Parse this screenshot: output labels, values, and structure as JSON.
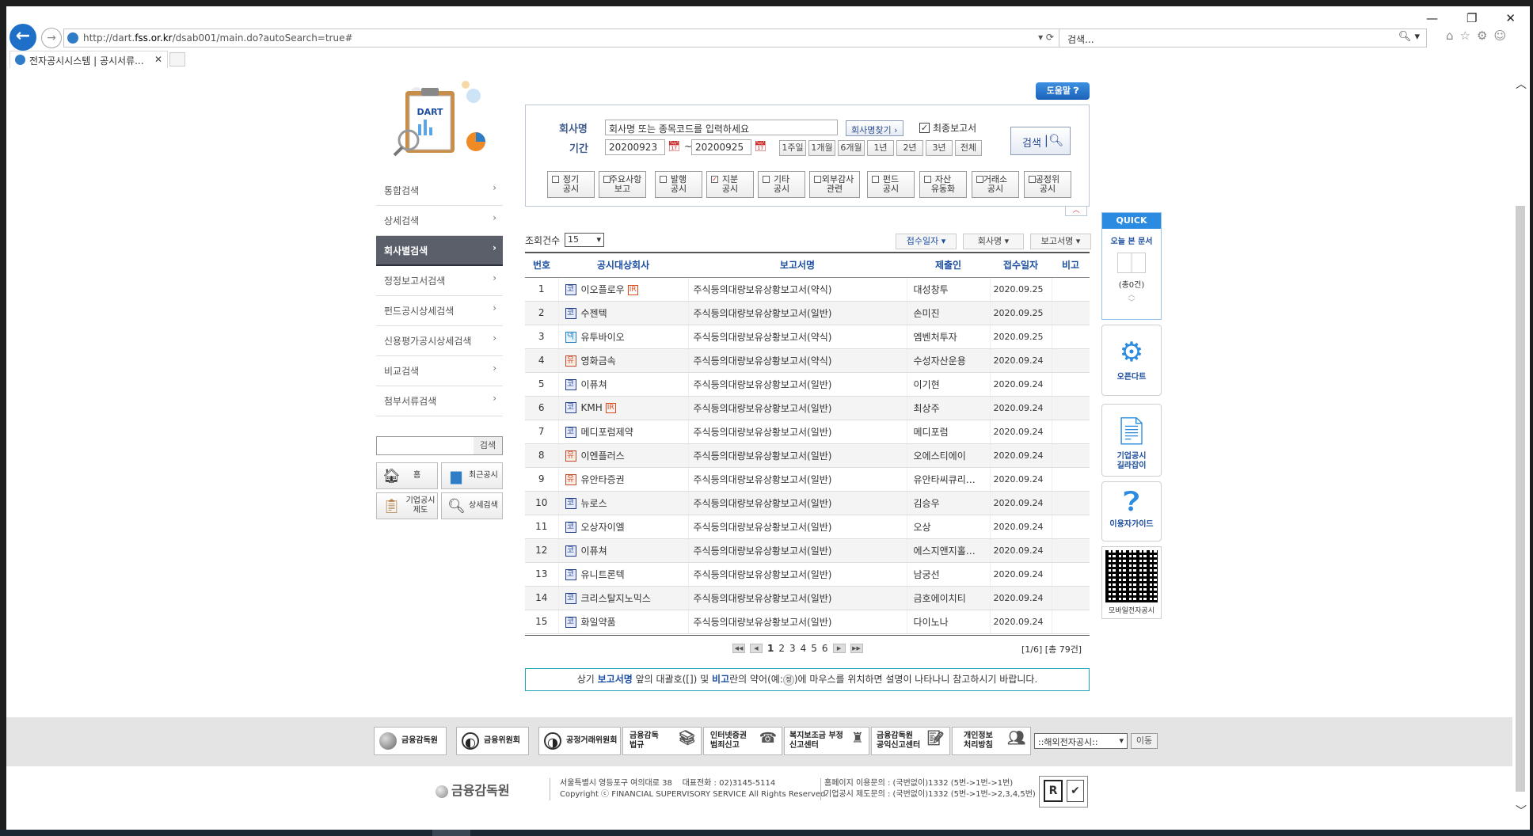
{
  "browser": {
    "url_prefix": "http://dart.",
    "url_host": "fss.or.kr",
    "url_rest": "/dsab001/main.do?autoSearch=true#",
    "search_placeholder": "검색...",
    "tab_title": "전자공시시스템 | 공시서류..."
  },
  "sidebar": {
    "logo_text": "DART",
    "items": [
      {
        "label": "통합검색"
      },
      {
        "label": "상세검색"
      },
      {
        "label": "회사별검색",
        "active": true
      },
      {
        "label": "정정보고서검색"
      },
      {
        "label": "펀드공시상세검색"
      },
      {
        "label": "신용평가공시상세검색"
      },
      {
        "label": "비교검색"
      },
      {
        "label": "첨부서류검색"
      }
    ],
    "search_button": "검색",
    "quick_buttons": [
      {
        "label": "홈",
        "icon": "home-icon"
      },
      {
        "label": "최근공시",
        "icon": "bar-chart-icon"
      },
      {
        "label": "기업공시 제도",
        "icon": "clipboard-icon"
      },
      {
        "label": "상세검색",
        "icon": "magnifier-icon"
      }
    ]
  },
  "search": {
    "help_label": "도움말",
    "company_label": "회사명",
    "company_value": "회사명 또는 종목코드를 입력하세요",
    "find_company_button": "회사명찾기",
    "latest_report_label": "최종보고서",
    "latest_report_checked": true,
    "period_label": "기간",
    "date_from": "20200923",
    "date_to": "20200925",
    "date_separator": "~",
    "period_buttons": [
      "1주일",
      "1개월",
      "6개월",
      "1년",
      "2년",
      "3년",
      "전체"
    ],
    "search_button": "검색",
    "categories": [
      {
        "label": "정기\n공시",
        "checked": false
      },
      {
        "label": "주요사항\n보고",
        "checked": false
      },
      {
        "label": "발행\n공시",
        "checked": false
      },
      {
        "label": "지분\n공시",
        "checked": true
      },
      {
        "label": "기타\n공시",
        "checked": false
      },
      {
        "label": "외부감사\n관련",
        "checked": false
      },
      {
        "label": "펀드\n공시",
        "checked": false
      },
      {
        "label": "자산\n유동화",
        "checked": false
      },
      {
        "label": "거래소\n공시",
        "checked": false
      },
      {
        "label": "공정위\n공시",
        "checked": false
      }
    ]
  },
  "results": {
    "count_label": "조회건수",
    "count_value": "15",
    "sort_buttons": [
      "접수일자",
      "회사명",
      "보고서명"
    ],
    "headers": [
      "번호",
      "공시대상회사",
      "보고서명",
      "제출인",
      "접수일자",
      "비고"
    ],
    "rows": [
      {
        "no": "1",
        "market": "코",
        "company": "이오플로우",
        "ir": "IR",
        "report": "주식등의대량보유상황보고서(약식)",
        "submitter": "대성창투",
        "date": "2020.09.25"
      },
      {
        "no": "2",
        "market": "코",
        "company": "수젠텍",
        "ir": "",
        "report": "주식등의대량보유상황보고서(일반)",
        "submitter": "손미진",
        "date": "2020.09.25"
      },
      {
        "no": "3",
        "market": "넥",
        "company": "유투바이오",
        "ir": "",
        "report": "주식등의대량보유상황보고서(약식)",
        "submitter": "엠벤처투자",
        "date": "2020.09.25"
      },
      {
        "no": "4",
        "market": "유",
        "company": "영화금속",
        "ir": "",
        "report": "주식등의대량보유상황보고서(약식)",
        "submitter": "수성자산운용",
        "date": "2020.09.24"
      },
      {
        "no": "5",
        "market": "코",
        "company": "이퓨쳐",
        "ir": "",
        "report": "주식등의대량보유상황보고서(일반)",
        "submitter": "이기현",
        "date": "2020.09.24"
      },
      {
        "no": "6",
        "market": "코",
        "company": "KMH",
        "ir": "IR",
        "report": "주식등의대량보유상황보고서(일반)",
        "submitter": "최상주",
        "date": "2020.09.24"
      },
      {
        "no": "7",
        "market": "코",
        "company": "메디포럼제약",
        "ir": "",
        "report": "주식등의대량보유상황보고서(일반)",
        "submitter": "메디포럼",
        "date": "2020.09.24"
      },
      {
        "no": "8",
        "market": "유",
        "company": "이엔플러스",
        "ir": "",
        "report": "주식등의대량보유상황보고서(일반)",
        "submitter": "오에스티에이",
        "date": "2020.09.24"
      },
      {
        "no": "9",
        "market": "유",
        "company": "유안타증권",
        "ir": "",
        "report": "주식등의대량보유상황보고서(일반)",
        "submitter": "유안타씨큐리…",
        "date": "2020.09.24"
      },
      {
        "no": "10",
        "market": "코",
        "company": "뉴로스",
        "ir": "",
        "report": "주식등의대량보유상황보고서(일반)",
        "submitter": "김승우",
        "date": "2020.09.24"
      },
      {
        "no": "11",
        "market": "코",
        "company": "오상자이엘",
        "ir": "",
        "report": "주식등의대량보유상황보고서(일반)",
        "submitter": "오상",
        "date": "2020.09.24"
      },
      {
        "no": "12",
        "market": "코",
        "company": "이퓨쳐",
        "ir": "",
        "report": "주식등의대량보유상황보고서(일반)",
        "submitter": "에스지앤지홀…",
        "date": "2020.09.24"
      },
      {
        "no": "13",
        "market": "코",
        "company": "유니트론텍",
        "ir": "",
        "report": "주식등의대량보유상황보고서(일반)",
        "submitter": "남궁선",
        "date": "2020.09.24"
      },
      {
        "no": "14",
        "market": "코",
        "company": "크리스탈지노믹스",
        "ir": "",
        "report": "주식등의대량보유상황보고서(일반)",
        "submitter": "금호에이치티",
        "date": "2020.09.24"
      },
      {
        "no": "15",
        "market": "코",
        "company": "화일약품",
        "ir": "",
        "report": "주식등의대량보유상황보고서(일반)",
        "submitter": "다이노나",
        "date": "2020.09.24"
      }
    ],
    "pages": [
      "1",
      "2",
      "3",
      "4",
      "5",
      "6"
    ],
    "current_page": "1",
    "page_info": "[1/6] [총 79건]"
  },
  "notice": {
    "p1": "상기 ",
    "b1": "보고서명",
    "p2": " 앞의 대괄호([]) 및 ",
    "b2": "비고",
    "p3": "란의 약어(예:",
    "tag": "정",
    "p4": ")에 마우스를 위치하면 설명이 나타나니 참고하시기 바랍니다."
  },
  "quick": {
    "header": "QUICK",
    "today_docs": "오늘 본 문서",
    "count": "(총0건)",
    "opendart": "오픈다트",
    "corp_guide": "기업공시\n길라잡이",
    "user_guide": "이용자가이드",
    "mobile": "모바일전자공시"
  },
  "footer": {
    "links": [
      {
        "label": "금융감독원",
        "icon": "fss-logo-icon"
      },
      {
        "label": "금융위원회",
        "icon": "fsc-logo-icon"
      },
      {
        "label": "공정거래위원회",
        "icon": "ftc-logo-icon"
      },
      {
        "label": "금융감독\n법규",
        "icon": "books-icon"
      },
      {
        "label": "인터넷증권\n범죄신고",
        "icon": "phone-icon"
      },
      {
        "label": "복지보조금 부정\n신고센터",
        "icon": "report-icon"
      },
      {
        "label": "금융감독원\n공익신고센터",
        "icon": "document-icon"
      },
      {
        "label": "개인정보\n처리방침",
        "icon": "person-icon"
      }
    ],
    "site_select": "::해외전자공시::",
    "go_button": "이동",
    "org_name": "금융감독원",
    "address": "서울특별시 영등포구 여의대로 38    대표전화 : 02)3145-5114",
    "copyright": "Copyright ⓒ FINANCIAL SUPERVISORY SERVICE All Rights Reserved.",
    "contact1": "홈페이지 이용문의 : (국번없이)1332 (5번->1번->1번)",
    "contact2": "기업공시 제도문의 : (국번없이)1332 (5번->1번->2,3,4,5번)"
  }
}
